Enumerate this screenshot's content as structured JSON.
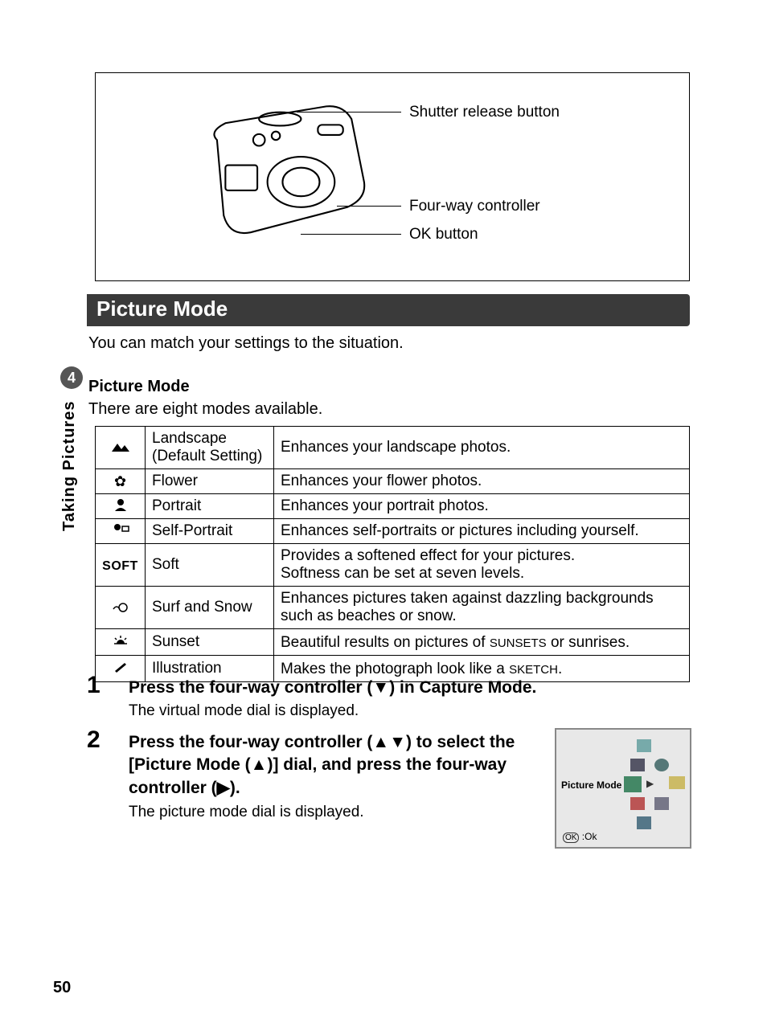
{
  "section_number": "4",
  "side_label": "Taking Pictures",
  "diagram": {
    "callouts": [
      "Shutter release button",
      "Four-way controller",
      "OK button"
    ]
  },
  "heading": "Picture Mode",
  "intro": "You can match your settings to the situation.",
  "sub_heading": "Picture Mode",
  "sub_text": "There are eight modes available.",
  "modes": [
    {
      "icon": "landscape-icon",
      "glyph": "▲",
      "name_line1": "Landscape",
      "name_line2": "(Default Setting)",
      "desc": "Enhances your landscape photos."
    },
    {
      "icon": "flower-icon",
      "glyph": "✿",
      "name": "Flower",
      "desc": "Enhances your flower photos."
    },
    {
      "icon": "portrait-icon",
      "glyph": "◐",
      "name": "Portrait",
      "desc": "Enhances your portrait photos."
    },
    {
      "icon": "self-portrait-icon",
      "glyph": "👤",
      "name": "Self-Portrait",
      "desc": "Enhances self-portraits or pictures including yourself."
    },
    {
      "icon": "soft-icon",
      "glyph": "SOFT",
      "name": "Soft",
      "desc_line1": "Provides a softened effect for your pictures.",
      "desc_line2": "Softness can be set at seven levels."
    },
    {
      "icon": "surf-snow-icon",
      "glyph": "⛄",
      "name": "Surf and Snow",
      "desc_line1": "Enhances pictures taken against dazzling backgrounds",
      "desc_line2": "such as beaches or snow."
    },
    {
      "icon": "sunset-icon",
      "glyph": "☼",
      "name": "Sunset",
      "desc_before": "Beautiful results on pictures of ",
      "desc_em": "sunsets",
      "desc_after": " or sunrises."
    },
    {
      "icon": "illustration-icon",
      "glyph": "✎",
      "name": "Illustration",
      "desc_before": "Makes the photograph look like a ",
      "desc_em": "sketch",
      "desc_after": "."
    }
  ],
  "steps": [
    {
      "num": "1",
      "head": "Press the four-way controller (▼) in Capture Mode.",
      "body": "The virtual mode dial is displayed."
    },
    {
      "num": "2",
      "head": "Press the four-way controller (▲▼) to select the [Picture Mode (▲)] dial, and press the four-way controller (▶).",
      "body": "The picture mode dial is displayed."
    }
  ],
  "dial_screen": {
    "label": "Picture Mode",
    "ok_hint": "OK :Ok",
    "icons": [
      "overlay-icon",
      "program-icon",
      "night-icon",
      "picture-mode-icon",
      "arrow-right",
      "3d-icon",
      "portrait-icon",
      "panorama-icon",
      "movie-icon"
    ]
  },
  "page_number": "50"
}
